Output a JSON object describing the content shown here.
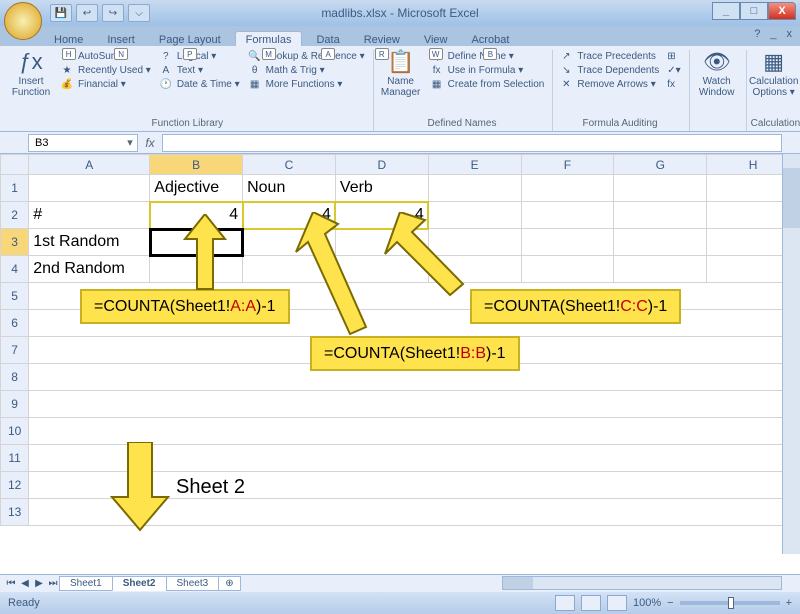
{
  "window": {
    "title": "madlibs.xlsx - Microsoft Excel",
    "min": "_",
    "max": "□",
    "close": "X"
  },
  "qat": {
    "b1": "↩",
    "b2": "↪",
    "b3": "⌵"
  },
  "tabs": {
    "home": {
      "label": "Home",
      "hint": "H"
    },
    "insert": {
      "label": "Insert",
      "hint": "N"
    },
    "layout": {
      "label": "Page Layout",
      "hint": "P"
    },
    "formulas": {
      "label": "Formulas",
      "hint": "M"
    },
    "data": {
      "label": "Data",
      "hint": "A"
    },
    "review": {
      "label": "Review",
      "hint": "R"
    },
    "view": {
      "label": "View",
      "hint": "W"
    },
    "acrobat": {
      "label": "Acrobat",
      "hint": "B"
    }
  },
  "help": {
    "q": "?",
    "min": "_",
    "x": "x"
  },
  "ribbon": {
    "insert_fn": "Insert\nFunction",
    "autosum": "AutoSum ▾",
    "recent": "Recently Used ▾",
    "financial": "Financial ▾",
    "logical": "Logical ▾",
    "text": "Text ▾",
    "datetime": "Date & Time ▾",
    "lookup": "Lookup & Reference ▾",
    "math": "Math & Trig ▾",
    "more": "More Functions ▾",
    "group_lib": "Function Library",
    "name_mgr": "Name\nManager",
    "def_name": "Define Name ▾",
    "use_formula": "Use in Formula ▾",
    "create_sel": "Create from Selection",
    "group_names": "Defined Names",
    "trace_prec": "Trace Precedents",
    "trace_dep": "Trace Dependents",
    "remove_arr": "Remove Arrows ▾",
    "show_f": "⊞",
    "err_chk": "✓▾",
    "eval_f": "fx",
    "group_audit": "Formula Auditing",
    "watch": "Watch\nWindow",
    "calc_opt": "Calculation\nOptions ▾",
    "group_calc": "Calculation"
  },
  "namebox": "B3",
  "fx": "fx",
  "columns": [
    "A",
    "B",
    "C",
    "D",
    "E",
    "F",
    "G",
    "H"
  ],
  "rows": [
    "1",
    "2",
    "3",
    "4",
    "5",
    "6",
    "7",
    "8",
    "9",
    "10",
    "11",
    "12",
    "13"
  ],
  "cells": {
    "B1": "Adjective",
    "C1": "Noun",
    "D1": "Verb",
    "A2": "#",
    "B2": "4",
    "C2": "4",
    "D2": "4",
    "A3": "1st Random",
    "A4": "2nd Random"
  },
  "annot": {
    "f1_pre": "=COUNTA(Sheet1!",
    "f1_red": "A:A",
    "f1_post": ")-1",
    "f2_pre": "=COUNTA(Sheet1!",
    "f2_red": "B:B",
    "f2_post": ")-1",
    "f3_pre": "=COUNTA(Sheet1!",
    "f3_red": "C:C",
    "f3_post": ")-1",
    "sheet2": "Sheet 2"
  },
  "sheets": {
    "nav": [
      "⏮",
      "◀",
      "▶",
      "⏭"
    ],
    "s1": "Sheet1",
    "s2": "Sheet2",
    "s3": "Sheet3",
    "new": "⊕"
  },
  "status": {
    "ready": "Ready",
    "zoom": "100%",
    "minus": "−",
    "plus": "+"
  }
}
